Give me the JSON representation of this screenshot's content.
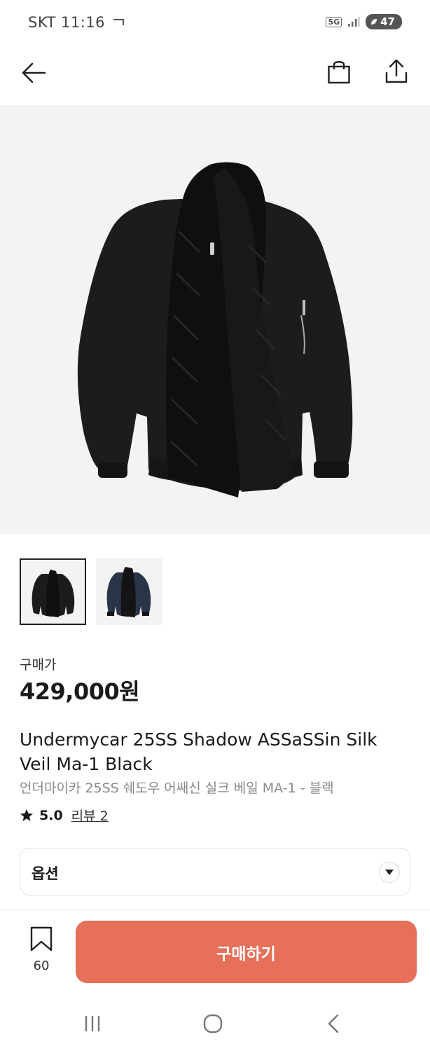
{
  "status_bar": {
    "carrier_time": "SKT 11:16",
    "network": "5G",
    "battery": "47"
  },
  "top_nav": {
    "back_icon": "arrow-left-icon",
    "bag_icon": "shopping-bag-icon",
    "share_icon": "share-icon"
  },
  "product": {
    "price_label": "구매가",
    "price": "429,000원",
    "title": "Undermycar 25SS Shadow ASSaSSin Silk Veil Ma-1 Black",
    "subtitle": "언더마이카 25SS 쉐도우 어쌔신 실크 베일 MA-1 - 블랙",
    "rating": "5.0",
    "review_label": "리뷰 2"
  },
  "thumbnails": [
    {
      "alt": "black",
      "selected": true
    },
    {
      "alt": "navy",
      "selected": false
    }
  ],
  "option": {
    "label": "옵션"
  },
  "bottom_bar": {
    "bookmark_count": "60",
    "buy_label": "구매하기"
  },
  "colors": {
    "accent": "#e6705a",
    "hero_bg": "#f3f3f3"
  }
}
